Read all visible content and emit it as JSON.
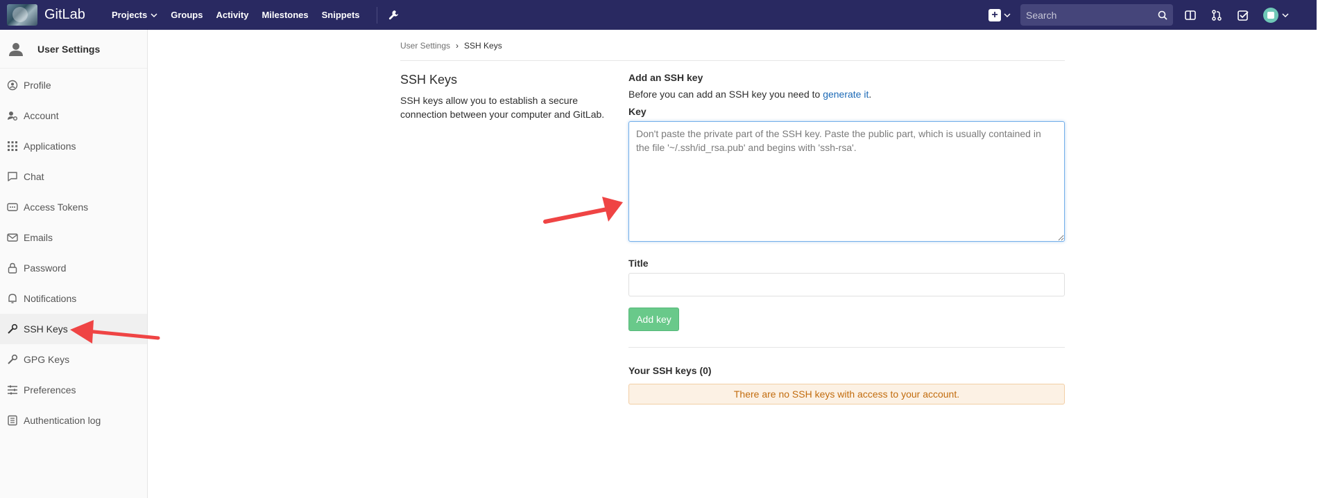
{
  "navbar": {
    "brand": "GitLab",
    "links": [
      {
        "label": "Projects",
        "dropdown": true
      },
      {
        "label": "Groups"
      },
      {
        "label": "Activity"
      },
      {
        "label": "Milestones"
      },
      {
        "label": "Snippets"
      }
    ],
    "search_placeholder": "Search"
  },
  "sidebar": {
    "title": "User Settings",
    "items": [
      {
        "label": "Profile",
        "icon": "profile-icon"
      },
      {
        "label": "Account",
        "icon": "account-icon"
      },
      {
        "label": "Applications",
        "icon": "applications-icon"
      },
      {
        "label": "Chat",
        "icon": "chat-icon"
      },
      {
        "label": "Access Tokens",
        "icon": "access-tokens-icon"
      },
      {
        "label": "Emails",
        "icon": "email-icon"
      },
      {
        "label": "Password",
        "icon": "lock-icon"
      },
      {
        "label": "Notifications",
        "icon": "bell-icon"
      },
      {
        "label": "SSH Keys",
        "icon": "key-icon",
        "active": true
      },
      {
        "label": "GPG Keys",
        "icon": "key-icon"
      },
      {
        "label": "Preferences",
        "icon": "preferences-icon"
      },
      {
        "label": "Authentication log",
        "icon": "log-icon"
      }
    ]
  },
  "breadcrumb": {
    "parent": "User Settings",
    "current": "SSH Keys"
  },
  "section": {
    "title": "SSH Keys",
    "description": "SSH keys allow you to establish a secure connection between your computer and GitLab."
  },
  "form": {
    "heading": "Add an SSH key",
    "intro_text": "Before you can add an SSH key you need to ",
    "intro_link": "generate it",
    "intro_end": ".",
    "key_label": "Key",
    "key_placeholder": "Don't paste the private part of the SSH key. Paste the public part, which is usually contained in the file '~/.ssh/id_rsa.pub' and begins with 'ssh-rsa'.",
    "title_label": "Title",
    "title_value": "",
    "submit_label": "Add key"
  },
  "keys": {
    "heading": "Your SSH keys (0)",
    "empty_message": "There are no SSH keys with access to your account."
  },
  "colors": {
    "navbar": "#292961",
    "link": "#1b69b6",
    "submit": "#69c98a",
    "annotation_arrow": "#ef4444"
  }
}
